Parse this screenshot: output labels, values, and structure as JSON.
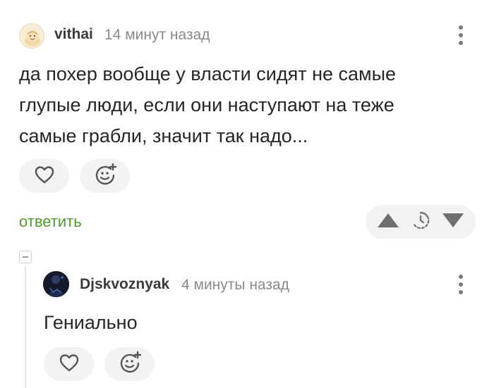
{
  "comment": {
    "username": "vithai",
    "time": "14 минут назад",
    "text": "да похер вообще у власти сидят не самые глупые люди, если они наступают на теже самые грабли, значит так надо...",
    "reply_label": "ответить",
    "icons": {
      "like": "heart-icon",
      "react": "smiley-plus-icon",
      "more": "kebab-menu-icon"
    }
  },
  "rating": {
    "icons": [
      "upvote-triangle-icon",
      "timer-icon",
      "downvote-triangle-icon"
    ]
  },
  "reply": {
    "username": "Djskvoznyak",
    "time": "4 минуты назад",
    "text": "Гениально",
    "icons": {
      "like": "heart-icon",
      "react": "smiley-plus-icon",
      "more": "kebab-menu-icon"
    }
  },
  "colors": {
    "accent_green": "#4f9a2e",
    "pill_bg": "#f2f3f5",
    "icon_gray": "#555555"
  }
}
